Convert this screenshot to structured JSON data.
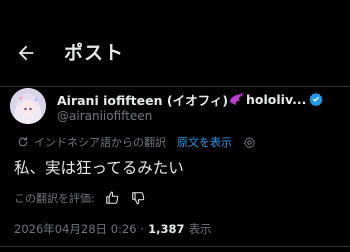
{
  "header": {
    "title": "ポスト",
    "back_icon": "arrow-left-icon"
  },
  "post": {
    "author": {
      "display_name": "Airani iofifteen (イオフィ)",
      "display_name_suffix": "hololiv...",
      "emoji_icon": "paint-emoji-icon",
      "verified_color": "#1d9bf0",
      "handle": "@airaniiofifteen"
    },
    "translation": {
      "note": "インドネシア語からの翻訳",
      "show_original": "原文を表示"
    },
    "text": "私、実は狂ってるみたい",
    "rate": {
      "label": "この翻訳を評価:"
    },
    "meta": {
      "timestamp": "2026年04月28日 0:26",
      "separator": "·",
      "views": "1,387",
      "views_label": "表示"
    }
  },
  "colors": {
    "background": "#000000",
    "text": "#e7e9ea",
    "muted": "#71767b",
    "accent": "#1d9bf0",
    "emoji": "#c23ad8"
  }
}
